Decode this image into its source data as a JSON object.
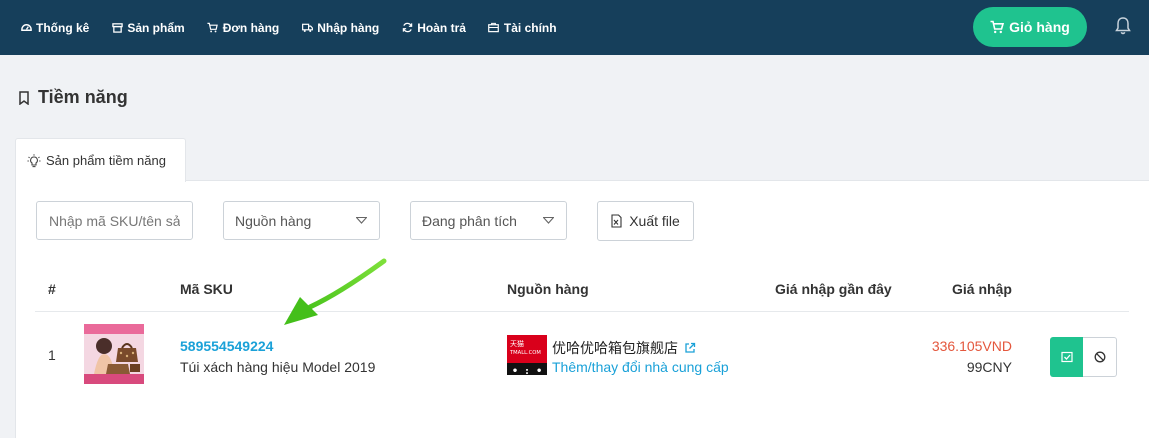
{
  "nav": {
    "items": [
      {
        "label": "Thống kê",
        "icon": "dashboard-icon"
      },
      {
        "label": "Sản phẩm",
        "icon": "box-icon"
      },
      {
        "label": "Đơn hàng",
        "icon": "cart-icon"
      },
      {
        "label": "Nhập hàng",
        "icon": "truck-icon"
      },
      {
        "label": "Hoàn trả",
        "icon": "refresh-icon"
      },
      {
        "label": "Tài chính",
        "icon": "wallet-icon"
      }
    ],
    "cart_label": "Giỏ hàng"
  },
  "page": {
    "title": "Tiềm năng"
  },
  "tab": {
    "label": "Sản phẩm tiềm năng"
  },
  "filters": {
    "search_placeholder": "Nhập mã SKU/tên sản phẩm",
    "source_label": "Nguồn hàng",
    "status_label": "Đang phân tích",
    "export_label": "Xuất file"
  },
  "table": {
    "headers": [
      "#",
      "Mã SKU",
      "Nguồn hàng",
      "Giá nhập gần đây",
      "Giá nhập"
    ],
    "rows": [
      {
        "index": "1",
        "sku": "589554549224",
        "product_name": "Túi xách hàng hiệu Model 2019",
        "store_name": "优哈优哈箱包旗舰店",
        "store_logo_text": "天猫\nTMALL.COM",
        "change_supplier": "Thêm/thay đổi nhà cung cấp",
        "recent_price": "",
        "price_vnd": "336.105VND",
        "price_cny": "99CNY"
      }
    ]
  },
  "colors": {
    "topbar": "#163f5b",
    "accent_green": "#1fc38f",
    "link_blue": "#1aa1d8",
    "price_red": "#e4573d"
  }
}
